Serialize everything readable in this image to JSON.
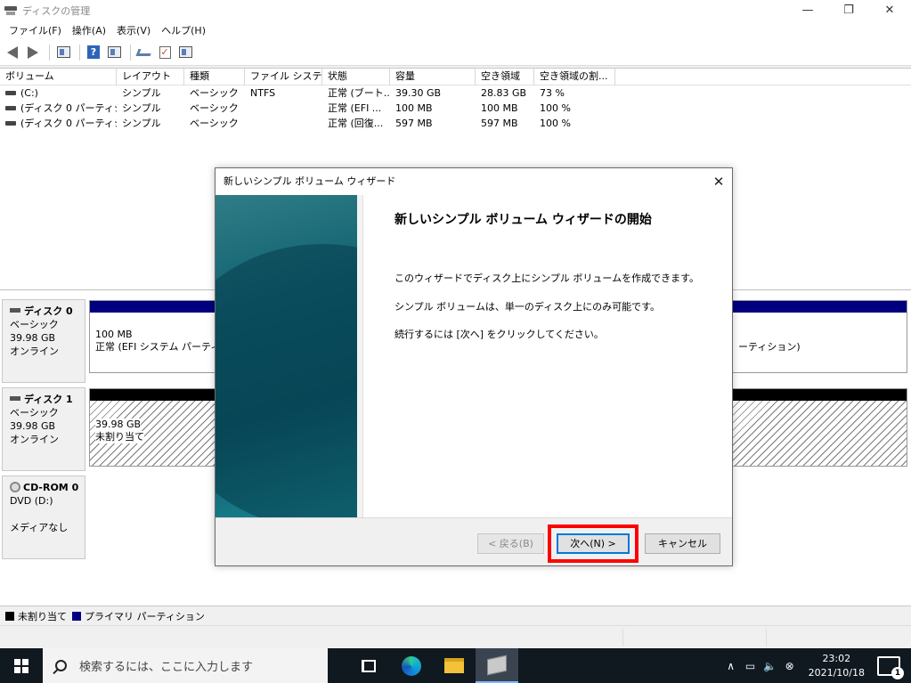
{
  "window": {
    "title": "ディスクの管理",
    "controls": {
      "minimize": "—",
      "maximize": "❐",
      "close": "✕"
    }
  },
  "menu": [
    "ファイル(F)",
    "操作(A)",
    "表示(V)",
    "ヘルプ(H)"
  ],
  "toolbar": {
    "icons": [
      "back-icon",
      "forward-icon",
      "console-tree-icon",
      "help-icon",
      "properties-icon",
      "connect-icon",
      "check-icon",
      "list-icon"
    ],
    "help_glyph": "?",
    "check_glyph": "✓"
  },
  "volume_list": {
    "columns": [
      "ボリューム",
      "レイアウト",
      "種類",
      "ファイル システム",
      "状態",
      "容量",
      "空き領域",
      "空き領域の割..."
    ],
    "rows": [
      [
        "(C:)",
        "シンプル",
        "ベーシック",
        "NTFS",
        "正常 (ブート...",
        "39.30 GB",
        "28.83 GB",
        "73 %"
      ],
      [
        "(ディスク 0 パーティシ...",
        "シンプル",
        "ベーシック",
        "",
        "正常 (EFI ...",
        "100 MB",
        "100 MB",
        "100 %"
      ],
      [
        "(ディスク 0 パーティシ...",
        "シンプル",
        "ベーシック",
        "",
        "正常 (回復...",
        "597 MB",
        "597 MB",
        "100 %"
      ]
    ]
  },
  "disks": [
    {
      "name": "ディスク 0",
      "type": "ベーシック",
      "size": "39.98 GB",
      "status": "オンライン",
      "partition_size": "100 MB",
      "partition_status": "正常 (EFI システム パーティシ",
      "right_partition_text": "ーティション)"
    },
    {
      "name": "ディスク 1",
      "type": "ベーシック",
      "size": "39.98 GB",
      "status": "オンライン",
      "partition_size": "39.98 GB",
      "partition_status": "未割り当て"
    },
    {
      "name": "CD-ROM 0",
      "type": "DVD (D:)",
      "size": "",
      "status": "メディアなし"
    }
  ],
  "legend": {
    "unallocated": "未割り当て",
    "primary": "プライマリ パーティション",
    "unallocated_color": "#000000",
    "primary_color": "#00007f"
  },
  "dialog": {
    "title": "新しいシンプル ボリューム ウィザード",
    "close_glyph": "✕",
    "heading": "新しいシンプル ボリューム ウィザードの開始",
    "line1": "このウィザードでディスク上にシンプル ボリュームを作成できます。",
    "line2": "シンプル ボリュームは、単一のディスク上にのみ可能です。",
    "line3": "続行するには [次へ] をクリックしてください。",
    "back_label": "< 戻る(B)",
    "next_label": "次へ(N) >",
    "cancel_label": "キャンセル"
  },
  "taskbar": {
    "search_placeholder": "検索するには、ここに入力します",
    "time": "23:02",
    "date": "2021/10/18",
    "notification_count": "1",
    "tray_glyphs": {
      "chevron": "∧",
      "network": "▭",
      "volume": "🔈",
      "error": "⊗"
    }
  },
  "colors": {
    "highlight": "#ff0000",
    "primary_partition": "#00007f",
    "accent": "#0078d7"
  }
}
